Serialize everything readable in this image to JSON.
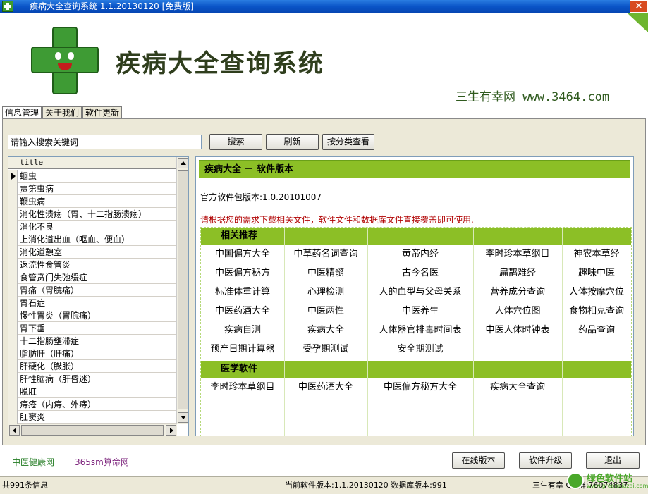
{
  "window": {
    "title": "疾病大全查询系统 1.1.20130120 [免费版]",
    "close": "×"
  },
  "banner": {
    "heading": "疾病大全查询系统",
    "site": "三生有幸网 www.3464.com"
  },
  "tabs": [
    "信息管理",
    "关于我们",
    "软件更新"
  ],
  "search": {
    "value": "请输入搜索关键词",
    "search_label": "搜索",
    "refresh_label": "刷新",
    "category_label": "按分类查看"
  },
  "list": {
    "column": "title",
    "items": [
      "蛔虫",
      "贾第虫病",
      "鞭虫病",
      "消化性溃疡（胃、十二指肠溃疡）",
      "消化不良",
      "上消化道出血（呕血、便血）",
      "消化道憩室",
      "返流性食管炎",
      "食管贲门失弛缓症",
      "胃痛（胃脘痛）",
      "胃石症",
      "慢性胃炎（胃脘痛）",
      "胃下垂",
      "十二指肠壅滞症",
      "脂肪肝（肝痛）",
      "肝硬化（臌胀）",
      "肝性脑病（肝昏迷）",
      "脱肛",
      "痔疮（内痔、外痔）",
      "肛窦炎"
    ]
  },
  "content": {
    "title": "疾病大全 － 软件版本",
    "official": "官方软件包版本:1.0.20101007",
    "notice": "请根据您的需求下载相关文件，软件文件和数据库文件直接覆盖即可使用.",
    "section1": "相关推荐",
    "section1_links": [
      [
        "中国偏方大全",
        "中草药名词查询",
        "黄帝内经",
        "李时珍本草纲目",
        "神农本草经"
      ],
      [
        "中医偏方秘方",
        "中医精髓",
        "古今名医",
        "扁鹊难经",
        "趣味中医"
      ],
      [
        "标准体重计算",
        "心理检测",
        "人的血型与父母关系",
        "营养成分查询",
        "人体按摩穴位"
      ],
      [
        "中医药酒大全",
        "中医两性",
        "中医养生",
        "人体穴位图",
        "食物相克查询"
      ],
      [
        "疾病自测",
        "疾病大全",
        "人体器官排毒时间表",
        "中医人体时钟表",
        "药品查询"
      ],
      [
        "预产日期计算器",
        "受孕期测试",
        "安全期测试",
        "",
        ""
      ]
    ],
    "section2": "医学软件",
    "section2_links": [
      "李时珍本草纲目",
      "中医药酒大全",
      "中医偏方秘方大全",
      "疾病大全查询",
      ""
    ]
  },
  "footer": {
    "link1": "中医健康网",
    "link2": "365sm算命网",
    "online_label": "在线版本",
    "upgrade_label": "软件升级",
    "exit_label": "退出"
  },
  "status": {
    "count": "共991条信息",
    "version": "当前软件版本:1.1.20130120 数据库版本:991",
    "contact": "三生有幸 QQ群:76074837"
  },
  "watermark": {
    "text": "绿色软件站",
    "sub": "www.greenxiazai.com"
  },
  "colors": {
    "accent_green": "#8cbf26",
    "title_blue": "#0a55c8",
    "notice_red": "#b00000"
  }
}
